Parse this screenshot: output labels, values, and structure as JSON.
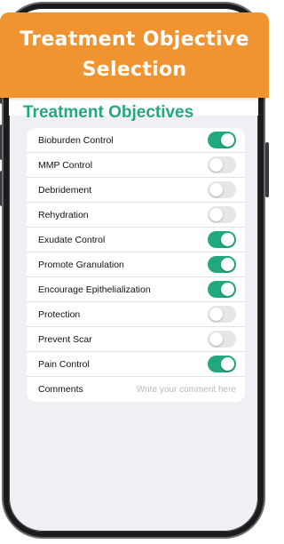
{
  "banner": {
    "title_line1": "Treatment Objective",
    "title_line2": "Selection"
  },
  "section": {
    "title": "Treatment Objectives"
  },
  "objectives": [
    {
      "label": "Bioburden Control",
      "enabled": true
    },
    {
      "label": "MMP Control",
      "enabled": false
    },
    {
      "label": "Debridement",
      "enabled": false
    },
    {
      "label": "Rehydration",
      "enabled": false
    },
    {
      "label": "Exudate Control",
      "enabled": true
    },
    {
      "label": "Promote Granulation",
      "enabled": true
    },
    {
      "label": "Encourage Epithelialization",
      "enabled": true
    },
    {
      "label": "Protection",
      "enabled": false
    },
    {
      "label": "Prevent Scar",
      "enabled": false
    },
    {
      "label": "Pain Control",
      "enabled": true
    }
  ],
  "comments": {
    "label": "Comments",
    "value": "",
    "placeholder": "Write your comment here"
  },
  "colors": {
    "banner": "#ef9430",
    "accent_green": "#23a87d",
    "toggle_off": "#e6e6ea",
    "background": "#efeff4"
  }
}
